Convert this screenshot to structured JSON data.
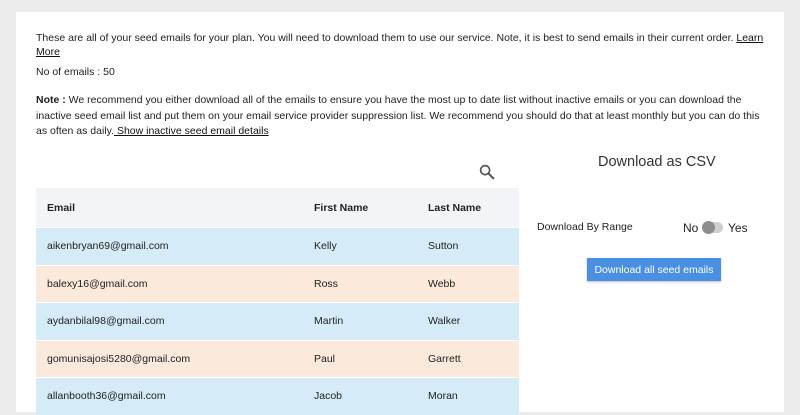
{
  "intro": {
    "text": "These are all of your seed emails for your plan. You will need to download them to use our service. Note, it is best to send emails in their current order. ",
    "learn_more": "Learn More"
  },
  "count_text": "No of emails : 50",
  "note": {
    "label": "Note :",
    "text": " We recommend you either download all of the emails to ensure you have the most up to date list without inactive emails or you can download the inactive seed email list and put them on your email service provider suppression list. We recommend you should do that at least monthly but you can do this as often as daily.",
    "link": " Show inactive seed email details"
  },
  "table": {
    "headers": [
      "Email",
      "First Name",
      "Last Name"
    ],
    "rows": [
      [
        "aikenbryan69@gmail.com",
        "Kelly",
        "Sutton"
      ],
      [
        "balexy16@gmail.com",
        "Ross",
        "Webb"
      ],
      [
        "aydanbilal98@gmail.com",
        "Martin",
        "Walker"
      ],
      [
        "gomunisajosi5280@gmail.com",
        "Paul",
        "Garrett"
      ],
      [
        "allanbooth36@gmail.com",
        "Jacob",
        "Moran"
      ]
    ]
  },
  "csv": {
    "title": "Download as CSV",
    "range_label": "Download By Range",
    "toggle_no": "No",
    "toggle_yes": "Yes",
    "button": "Download all seed emails"
  },
  "colors": {
    "row_blue": "#d6ebf8",
    "row_peach": "#fbeadb",
    "button": "#4a90e2"
  }
}
